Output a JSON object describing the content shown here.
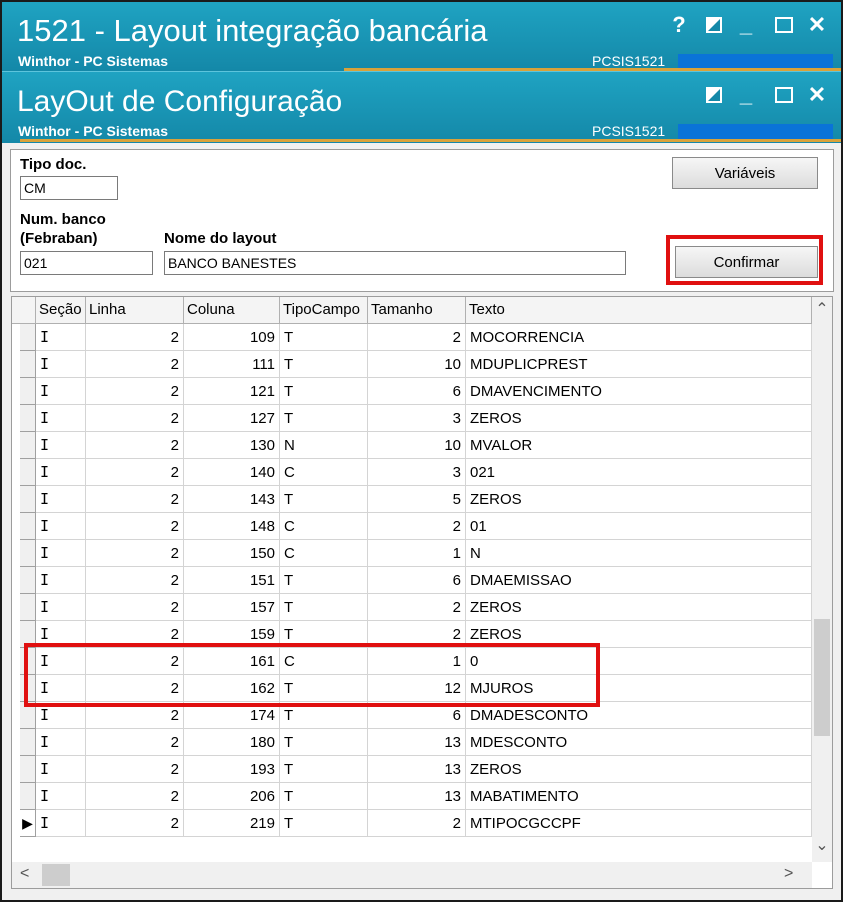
{
  "window_outer": {
    "title": "1521 - Layout integração bancária",
    "subtitle": "Winthor - PC Sistemas",
    "code": "PCSIS1521"
  },
  "window_inner": {
    "title": "LayOut de Configuração",
    "subtitle": "Winthor - PC Sistemas",
    "code": "PCSIS1521"
  },
  "icons": {
    "help": "?",
    "restore": "◪",
    "minimize": "_",
    "maximize": "☐",
    "close": "✕",
    "scroll_up": "⌃",
    "scroll_down": "⌄",
    "scroll_left": "<",
    "scroll_right": ">",
    "row_pointer": "▶"
  },
  "form": {
    "tipo_doc_label": "Tipo doc.",
    "tipo_doc_value": "CM",
    "num_banco_label_1": "Num. banco",
    "num_banco_label_2": "(Febraban)",
    "num_banco_value": "021",
    "nome_layout_label": "Nome do layout",
    "nome_layout_value": "BANCO BANESTES",
    "variaveis_button": "Variáveis",
    "confirmar_button": "Confirmar"
  },
  "grid": {
    "columns": [
      "Seção",
      "Linha",
      "Coluna",
      "TipoCampo",
      "Tamanho",
      "Texto"
    ],
    "rows": [
      {
        "secao": "I",
        "linha": "2",
        "coluna": "109",
        "tipo": "T",
        "tamanho": "2",
        "texto": "MOCORRENCIA"
      },
      {
        "secao": "I",
        "linha": "2",
        "coluna": "111",
        "tipo": "T",
        "tamanho": "10",
        "texto": "MDUPLICPREST"
      },
      {
        "secao": "I",
        "linha": "2",
        "coluna": "121",
        "tipo": "T",
        "tamanho": "6",
        "texto": "DMAVENCIMENTO"
      },
      {
        "secao": "I",
        "linha": "2",
        "coluna": "127",
        "tipo": "T",
        "tamanho": "3",
        "texto": "ZEROS"
      },
      {
        "secao": "I",
        "linha": "2",
        "coluna": "130",
        "tipo": "N",
        "tamanho": "10",
        "texto": "MVALOR"
      },
      {
        "secao": "I",
        "linha": "2",
        "coluna": "140",
        "tipo": "C",
        "tamanho": "3",
        "texto": "021"
      },
      {
        "secao": "I",
        "linha": "2",
        "coluna": "143",
        "tipo": "T",
        "tamanho": "5",
        "texto": "ZEROS"
      },
      {
        "secao": "I",
        "linha": "2",
        "coluna": "148",
        "tipo": "C",
        "tamanho": "2",
        "texto": "01"
      },
      {
        "secao": "I",
        "linha": "2",
        "coluna": "150",
        "tipo": "C",
        "tamanho": "1",
        "texto": "N"
      },
      {
        "secao": "I",
        "linha": "2",
        "coluna": "151",
        "tipo": "T",
        "tamanho": "6",
        "texto": "DMAEMISSAO"
      },
      {
        "secao": "I",
        "linha": "2",
        "coluna": "157",
        "tipo": "T",
        "tamanho": "2",
        "texto": "ZEROS"
      },
      {
        "secao": "I",
        "linha": "2",
        "coluna": "159",
        "tipo": "T",
        "tamanho": "2",
        "texto": "ZEROS"
      },
      {
        "secao": "I",
        "linha": "2",
        "coluna": "161",
        "tipo": "C",
        "tamanho": "1",
        "texto": "0"
      },
      {
        "secao": "I",
        "linha": "2",
        "coluna": "162",
        "tipo": "T",
        "tamanho": "12",
        "texto": "MJUROS"
      },
      {
        "secao": "I",
        "linha": "2",
        "coluna": "174",
        "tipo": "T",
        "tamanho": "6",
        "texto": "DMADESCONTO"
      },
      {
        "secao": "I",
        "linha": "2",
        "coluna": "180",
        "tipo": "T",
        "tamanho": "13",
        "texto": "MDESCONTO"
      },
      {
        "secao": "I",
        "linha": "2",
        "coluna": "193",
        "tipo": "T",
        "tamanho": "13",
        "texto": "ZEROS"
      },
      {
        "secao": "I",
        "linha": "2",
        "coluna": "206",
        "tipo": "T",
        "tamanho": "13",
        "texto": "MABATIMENTO"
      },
      {
        "secao": "I",
        "linha": "2",
        "coluna": "219",
        "tipo": "T",
        "tamanho": "2",
        "texto": "MTIPOCGCCPF"
      }
    ]
  },
  "colors": {
    "titlebar": "#1a95b8",
    "accent_line": "#d9a23a",
    "code_bar": "#0a73d8",
    "highlight": "#e01010"
  }
}
